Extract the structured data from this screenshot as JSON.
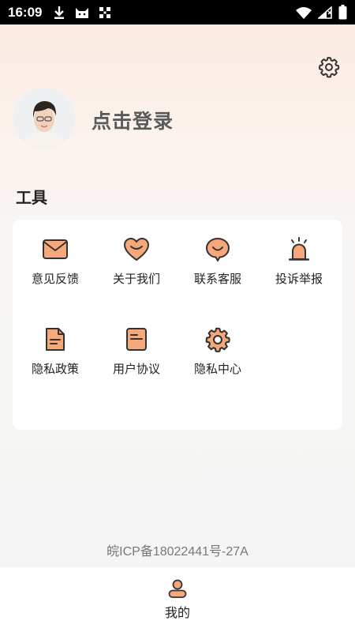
{
  "status_bar": {
    "time": "16:09",
    "left_icons": [
      "download-icon",
      "cat-icon",
      "qr-scan-icon"
    ],
    "right_icons": [
      "wifi-icon",
      "signal-icon",
      "battery-icon"
    ]
  },
  "header": {
    "settings_icon": "gear-icon",
    "login_text": "点击登录"
  },
  "tools": {
    "title": "工具",
    "accent_color": "#f7a87a",
    "stroke_color": "#333333",
    "items": [
      {
        "label": "意见反馈",
        "icon": "mail-icon"
      },
      {
        "label": "关于我们",
        "icon": "heart-icon"
      },
      {
        "label": "联系客服",
        "icon": "chat-smile-icon"
      },
      {
        "label": "投诉举报",
        "icon": "alarm-light-icon"
      },
      {
        "label": "隐私政策",
        "icon": "document-icon"
      },
      {
        "label": "用户协议",
        "icon": "notepad-icon"
      },
      {
        "label": "隐私中心",
        "icon": "gear-icon"
      }
    ]
  },
  "footer": {
    "icp": "皖ICP备18022441号-27A"
  },
  "bottom_nav": {
    "items": [
      {
        "label": "我的",
        "icon": "user-icon",
        "active": true
      }
    ]
  }
}
